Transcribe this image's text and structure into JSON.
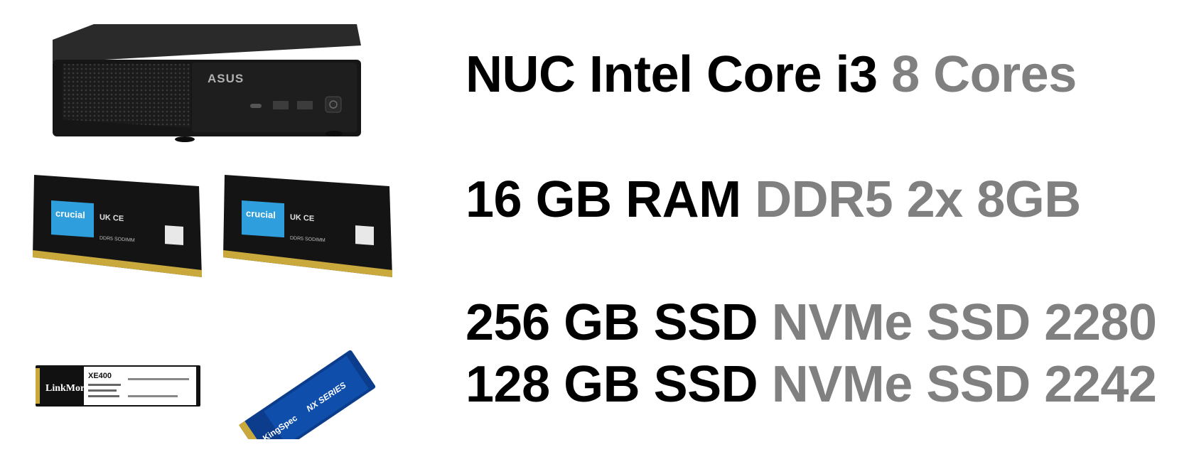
{
  "specs": {
    "cpu": {
      "primary": "NUC Intel Core i3",
      "secondary": "8 Cores"
    },
    "ram": {
      "primary": "16 GB RAM",
      "secondary": "DDR5 2x 8GB"
    },
    "ssd1": {
      "primary": "256 GB SSD",
      "secondary": "NVMe SSD 2280"
    },
    "ssd2": {
      "primary": "128 GB SSD",
      "secondary": "NVMe SSD 2242"
    }
  },
  "images": {
    "nuc": {
      "brand": "ASUS"
    },
    "ram_module_1": {
      "brand": "crucial",
      "model": "DDR5 SODIMM"
    },
    "ram_module_2": {
      "brand": "crucial",
      "model": "DDR5 SODIMM"
    },
    "ssd_linkmore": {
      "brand": "LinkMore",
      "model": "XE400"
    },
    "ssd_kingspec": {
      "brand": "KingSpec",
      "series": "NX SERIES"
    }
  },
  "colors": {
    "primary_text": "#000000",
    "secondary_text": "#808080",
    "background": "#ffffff",
    "crucial_label": "#2e9fdc",
    "kingspec_blue": "#0b3d8c"
  }
}
